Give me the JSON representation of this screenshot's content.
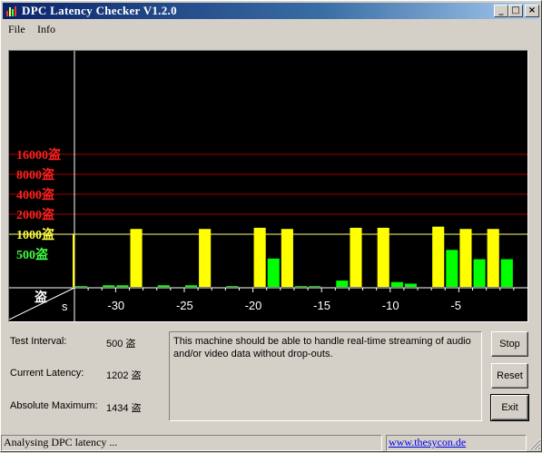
{
  "window": {
    "title": "DPC Latency Checker V1.2.0",
    "buttons": {
      "minimize": "_",
      "maximize": "□",
      "close": "×"
    }
  },
  "menu": {
    "items": [
      "File",
      "Info"
    ]
  },
  "chart_data": {
    "type": "bar",
    "scale": "logarithmic",
    "y_unit_glyph": "盗",
    "y_ticks": [
      {
        "label": "16000盗",
        "value": 16000,
        "color": "#ff2020"
      },
      {
        "label": "8000盗",
        "value": 8000,
        "color": "#ff2020"
      },
      {
        "label": "4000盗",
        "value": 4000,
        "color": "#ff2020"
      },
      {
        "label": "2000盗",
        "value": 2000,
        "color": "#ff2020"
      },
      {
        "label": "1000盗",
        "value": 1000,
        "color": "#ffff40"
      },
      {
        "label": "500盗",
        "value": 500,
        "color": "#40ff40"
      }
    ],
    "x_unit": "s",
    "x_ticks": [
      -30,
      -25,
      -20,
      -15,
      -10,
      -5
    ],
    "x_range": [
      -33,
      0
    ],
    "bar_values": [
      1000,
      165,
      160,
      170,
      170,
      1200,
      160,
      170,
      160,
      170,
      1200,
      160,
      165,
      160,
      1250,
      430,
      1200,
      165,
      165,
      160,
      200,
      1250,
      160,
      1250,
      190,
      180,
      160,
      1300,
      580,
      1200,
      420,
      1200,
      420,
      160
    ],
    "colors": {
      "green": "#00ff00",
      "yellow": "#ffff00",
      "gridline_red": "#a00000",
      "gridline_yellow": "#ffff80"
    }
  },
  "stats": {
    "test_interval_label": "Test Interval:",
    "test_interval_value": "500 盗",
    "current_latency_label": "Current Latency:",
    "current_latency_value": "1202 盗",
    "absolute_max_label": "Absolute Maximum:",
    "absolute_max_value": "1434 盗"
  },
  "message": "This machine should be able to handle real-time streaming of audio and/or video data without drop-outs.",
  "buttons": {
    "stop": "Stop",
    "reset": "Reset",
    "exit": "Exit"
  },
  "status": {
    "text": "Analysing DPC latency ...",
    "link": "www.thesycon.de"
  }
}
